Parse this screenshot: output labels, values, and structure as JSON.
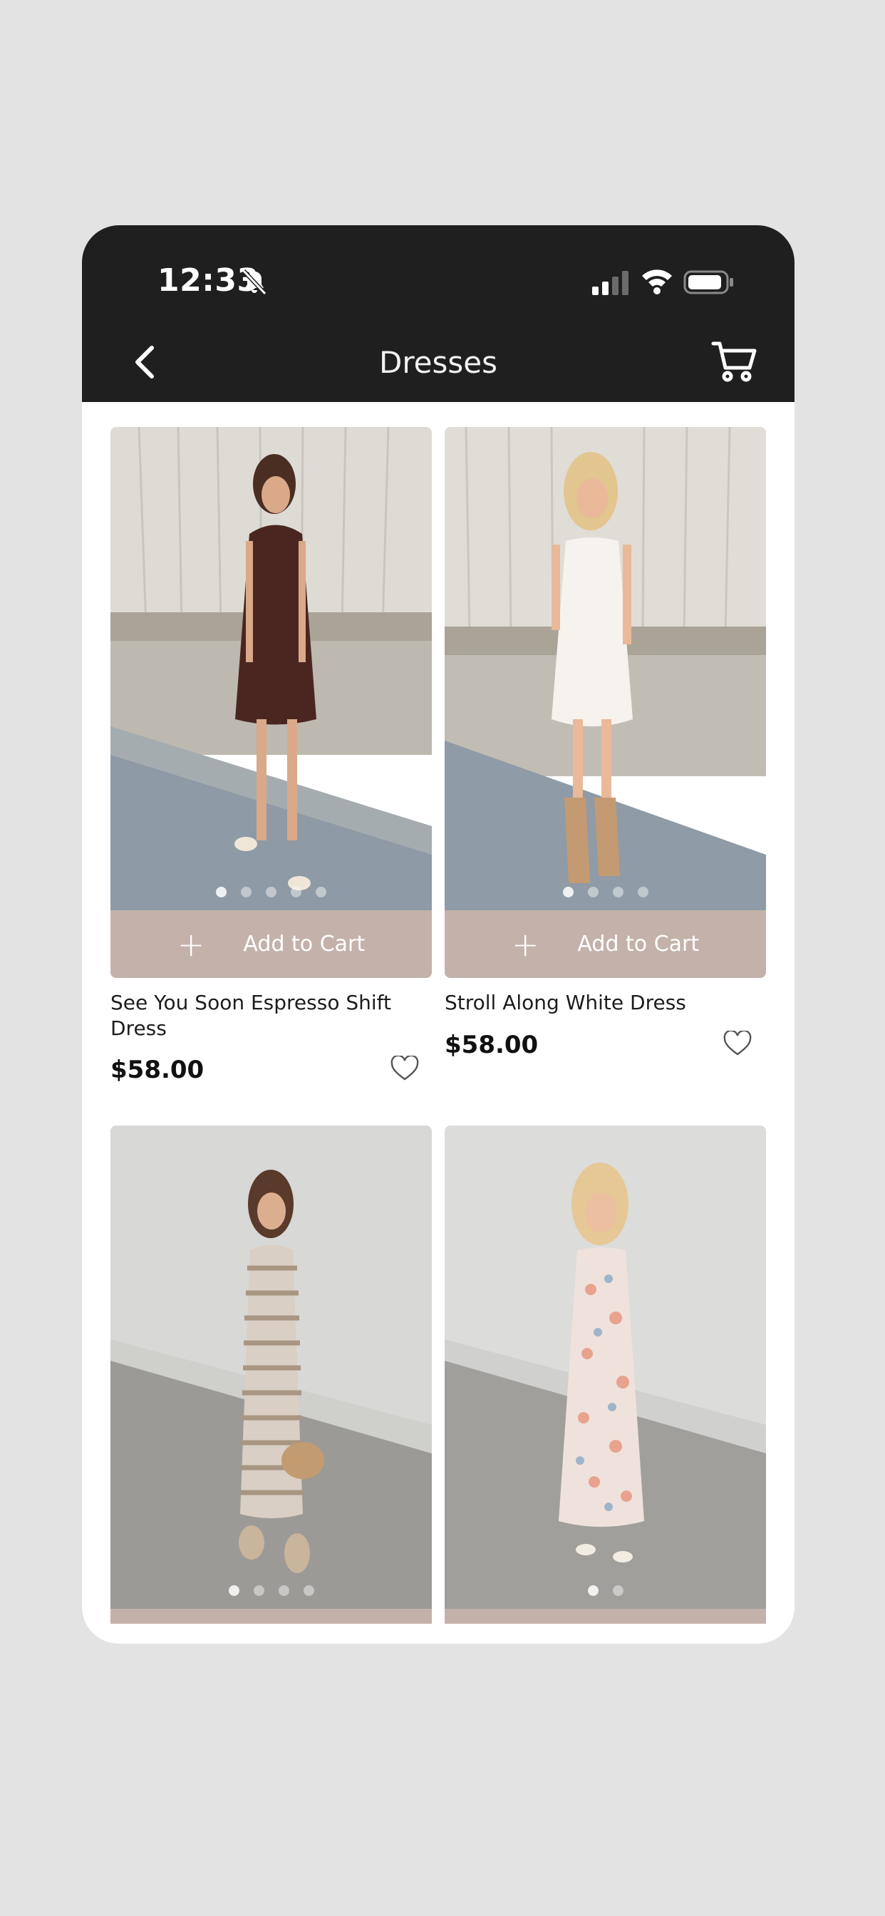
{
  "status_bar": {
    "time": "12:33"
  },
  "header": {
    "title": "Dresses"
  },
  "colors": {
    "header_bg": "#1f1f1f",
    "add_to_cart_bg": "#c4b2aa",
    "page_bg": "#e3e3e3"
  },
  "products": [
    {
      "name": "See You Soon Espresso Shift Dress",
      "price": "$58.00",
      "add_label": "Add to Cart",
      "image_dots": 5
    },
    {
      "name": "Stroll Along White Dress",
      "price": "$58.00",
      "add_label": "Add to Cart",
      "image_dots": 4
    },
    {
      "name": "",
      "price": "",
      "add_label": "",
      "image_dots": 4
    },
    {
      "name": "",
      "price": "",
      "add_label": "",
      "image_dots": 2
    }
  ],
  "icons": {
    "back": "chevron-left-icon",
    "cart": "cart-icon",
    "favorite": "heart-outline-icon",
    "add": "plus-icon",
    "notifications_muted": "bell-slash-icon"
  }
}
